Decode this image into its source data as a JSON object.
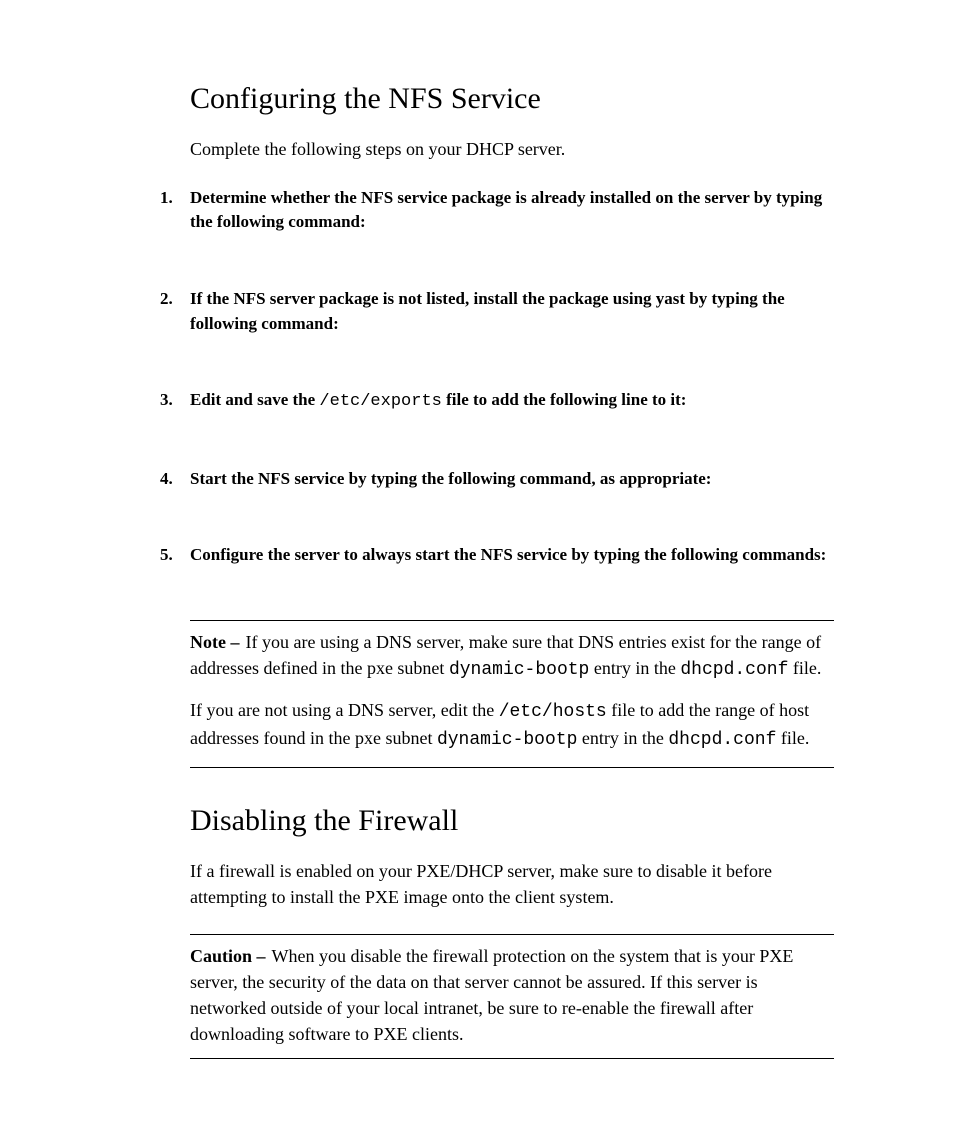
{
  "section1": {
    "title": "Configuring the NFS Service",
    "intro": "Complete the following steps on your DHCP server.",
    "steps": [
      {
        "num": "1.",
        "text": "Determine whether the NFS service package is already installed on the server by typing the following command:"
      },
      {
        "num": "2.",
        "text": "If the NFS server package is not listed, install the package using yast by typing the following command:"
      },
      {
        "num": "3.",
        "pre": "Edit and save the ",
        "mono": "/etc/exports",
        "post": " file to add the following line to it:"
      },
      {
        "num": "4.",
        "text": "Start the NFS service by typing the following command, as appropriate:"
      },
      {
        "num": "5.",
        "text": "Configure the server to always start the NFS service by typing the following commands:"
      }
    ]
  },
  "note": {
    "label": "Note –",
    "p1a": "If you are using a DNS server, make sure that DNS entries exist for the range of addresses defined in the pxe subnet ",
    "p1m1": "dynamic-bootp",
    "p1b": " entry in the ",
    "p1m2": "dhcpd.conf",
    "p1c": " file.",
    "p2a": "If you are not using a DNS server, edit the ",
    "p2m1": "/etc/hosts",
    "p2b": " file to add the range of host addresses found in the pxe subnet ",
    "p2m2": "dynamic-bootp",
    "p2c": " entry in the ",
    "p2m3": "dhcpd.conf",
    "p2d": " file."
  },
  "section2": {
    "title": "Disabling the Firewall",
    "intro": "If a firewall is enabled on your PXE/DHCP server, make sure to disable it before attempting to install the PXE image onto the client system."
  },
  "caution": {
    "label": "Caution –",
    "text": "When you disable the firewall protection on the system that is your PXE server, the security of the data on that server cannot be assured. If this server is networked outside of your local intranet, be sure to re-enable the firewall after downloading software to PXE clients."
  }
}
